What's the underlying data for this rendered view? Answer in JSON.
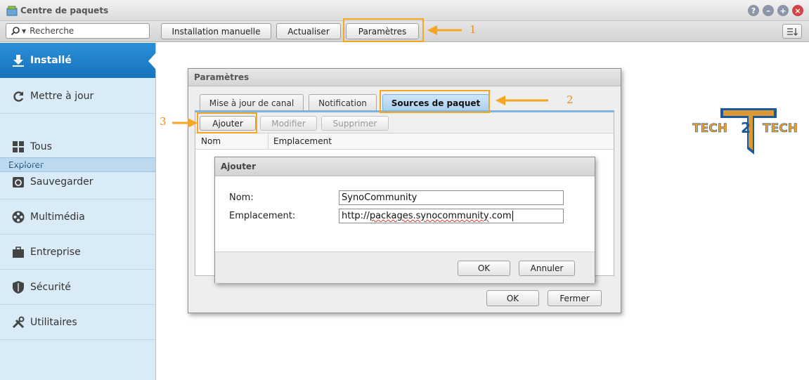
{
  "window": {
    "title": "Centre de paquets"
  },
  "toolbar": {
    "search_placeholder": "Recherche",
    "manual_install_label": "Installation manuelle",
    "refresh_label": "Actualiser",
    "settings_label": "Paramètres"
  },
  "sidebar": {
    "items": [
      {
        "label": "Installé",
        "icon": "download-icon",
        "active": true
      },
      {
        "label": "Mettre à jour",
        "icon": "refresh-icon"
      }
    ],
    "section_label": "Explorer",
    "categories": [
      {
        "label": "Tous",
        "icon": "grid-icon"
      },
      {
        "label": "Sauvegarder",
        "icon": "backup-icon"
      },
      {
        "label": "Multimédia",
        "icon": "film-reel-icon"
      },
      {
        "label": "Entreprise",
        "icon": "briefcase-icon"
      },
      {
        "label": "Sécurité",
        "icon": "shield-icon"
      },
      {
        "label": "Utilitaires",
        "icon": "tools-icon"
      }
    ]
  },
  "settings_dialog": {
    "title": "Paramètres",
    "tabs": [
      {
        "label": "Mise à jour de canal"
      },
      {
        "label": "Notification"
      },
      {
        "label": "Sources de paquet",
        "active": true
      }
    ],
    "actions": {
      "add": "Ajouter",
      "edit": "Modifier",
      "delete": "Supprimer"
    },
    "columns": {
      "name": "Nom",
      "location": "Emplacement"
    },
    "ok_label": "OK",
    "close_label": "Fermer"
  },
  "add_dialog": {
    "title": "Ajouter",
    "name_label": "Nom:",
    "name_value": "SynoCommunity",
    "location_label": "Emplacement:",
    "location_prefix": "http://",
    "location_value": "packages.synocommunity",
    "location_suffix": ".com",
    "ok_label": "OK",
    "cancel_label": "Annuler"
  },
  "callouts": {
    "one": "1",
    "two": "2",
    "three": "3"
  },
  "logo": {
    "left": "TECH",
    "middle": "2",
    "right": "TECH"
  },
  "colors": {
    "accent_blue": "#1a7bc6",
    "highlight_orange": "#f5a623",
    "logo_blue": "#1a5a9c",
    "logo_orange": "#f0a02a"
  }
}
